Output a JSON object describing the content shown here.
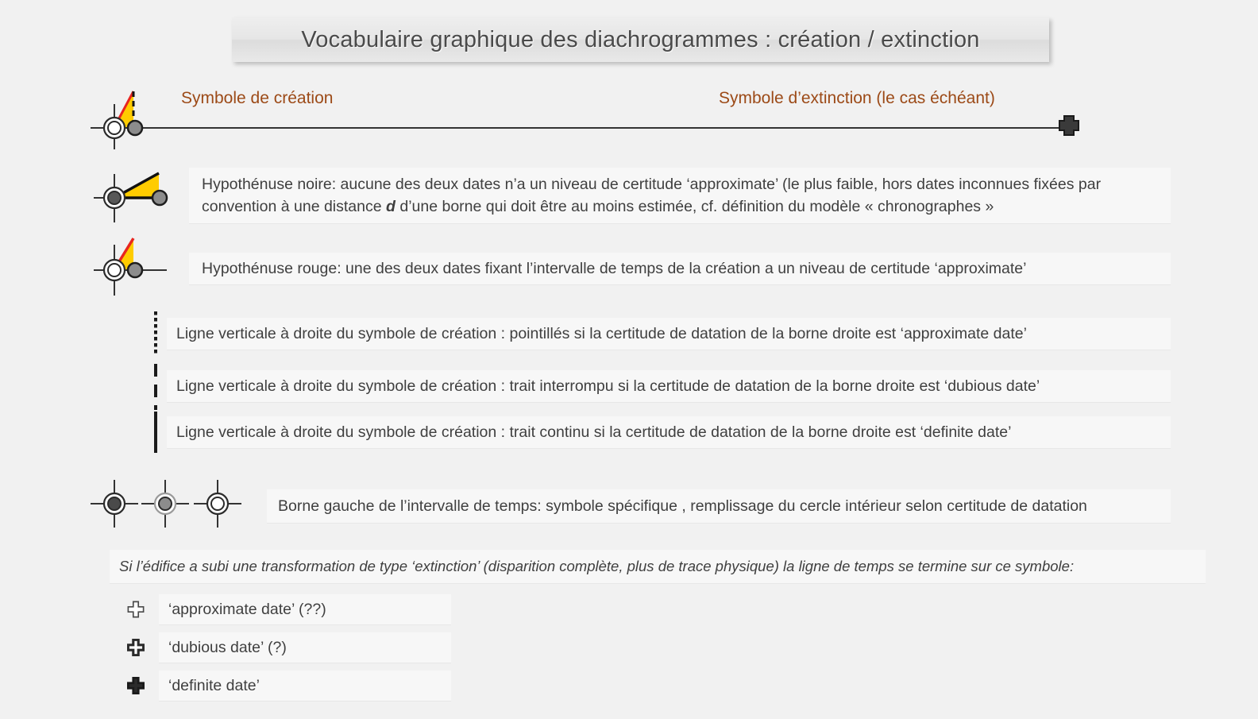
{
  "title": "Vocabulaire graphique des diachrogrammes : création / extinction",
  "timeline": {
    "creation_label": "Symbole de création",
    "extinction_label": "Symbole d’extinction (le cas échéant)",
    "creation_icon": "creation-symbol-red-hypotenuse-dashed",
    "extinction_icon": "extinction-cross-bold"
  },
  "rows": [
    {
      "id": "hypotenuse-noire",
      "icon": "creation-symbol-black-hypotenuse-filled-marker",
      "text_parts": [
        "Hypothénuse noire: aucune des deux dates n’a un niveau de certitude ‘approximate’ (le plus faible, hors dates inconnues fixées par convention à une distance ",
        "d",
        " d’une borne qui doit être au moins estimée, cf. définition du modèle « chronographes »"
      ],
      "text": "Hypothénuse noire: aucune des deux dates n’a un niveau de certitude ‘approximate’ (le plus faible, hors dates inconnues fixées par convention à une distance d d’une borne qui doit être au moins estimée, cf. définition du modèle « chronographes »"
    },
    {
      "id": "hypotenuse-rouge",
      "icon": "creation-symbol-red-hypotenuse-hollow-marker",
      "text": "Hypothénuse rouge: une des deux dates fixant l’intervalle de temps de la création a un niveau de certitude ‘approximate’"
    },
    {
      "id": "ligne-pointilles",
      "icon": "vertical-line-dotted",
      "text": "Ligne verticale à droite du symbole de création  : pointillés si la certitude de datation de la borne droite est ‘approximate date’"
    },
    {
      "id": "ligne-interrompu",
      "icon": "vertical-line-dashed",
      "text": "Ligne verticale à droite du symbole de création  : trait interrompu si la certitude de datation de la borne droite est ‘dubious date’"
    },
    {
      "id": "ligne-continu",
      "icon": "vertical-line-solid",
      "text": "Ligne verticale à droite du symbole de création  : trait continu si la certitude de datation de la borne droite est ‘definite date’"
    },
    {
      "id": "borne-gauche",
      "icon": "crosshair-markers-three-fills",
      "text": "Borne gauche de l’intervalle de temps: symbole spécifique , remplissage du cercle intérieur selon certitude de datation"
    }
  ],
  "extinction_section": {
    "intro": "Si l’édifice a subi une transformation de type ‘extinction’ (disparition complète, plus de trace physique) la ligne de temps se termine sur ce symbole:",
    "items": [
      {
        "icon": "cross-thin",
        "label": "‘approximate date’ (??)"
      },
      {
        "icon": "cross-medium",
        "label": "‘dubious date’ (?)"
      },
      {
        "icon": "cross-bold",
        "label": "‘definite date’"
      }
    ]
  },
  "colors": {
    "background": "#f1f1f1",
    "panel": "#f7f7f7",
    "heading_brown": "#9c4a17",
    "triangle_yellow": "#ffcc00",
    "hypotenuse_red": "#e8251f",
    "hypotenuse_black": "#111111",
    "marker_gray": "#8c8c8c",
    "marker_dark": "#4a4a4a",
    "text": "#3f3f3f",
    "title_text": "#4a4a4a"
  }
}
